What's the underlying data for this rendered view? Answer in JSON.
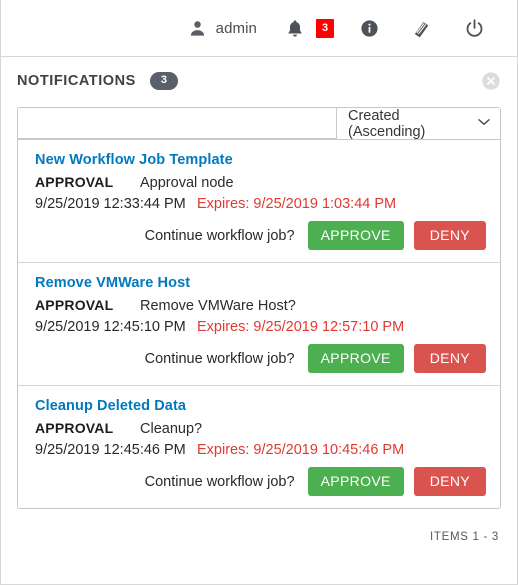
{
  "topbar": {
    "user_icon": "user-icon",
    "user_label": "admin",
    "bell_icon": "bell-icon",
    "bell_badge": "3",
    "info_icon": "info-circle-icon",
    "docs_icon": "book-icon",
    "logout_icon": "power-icon"
  },
  "panel": {
    "title": "NOTIFICATIONS",
    "count": "3",
    "close_icon": "close-circle-icon"
  },
  "toolbar": {
    "search_value": "",
    "search_placeholder": "",
    "sort_value": "Created (Ascending)",
    "sort_chevron": "chevron-down-icon"
  },
  "notifications": [
    {
      "title": "New Workflow Job Template",
      "type_label": "APPROVAL",
      "type_value": "Approval node",
      "created": "9/25/2019 12:33:44 PM",
      "expires": "Expires: 9/25/2019 1:03:44 PM",
      "prompt": "Continue workflow job?",
      "approve_label": "APPROVE",
      "deny_label": "DENY"
    },
    {
      "title": "Remove VMWare Host",
      "type_label": "APPROVAL",
      "type_value": "Remove VMWare Host?",
      "created": "9/25/2019 12:45:10 PM",
      "expires": "Expires: 9/25/2019 12:57:10 PM",
      "prompt": "Continue workflow job?",
      "approve_label": "APPROVE",
      "deny_label": "DENY"
    },
    {
      "title": "Cleanup Deleted Data",
      "type_label": "APPROVAL",
      "type_value": "Cleanup?",
      "created": "9/25/2019 12:45:46 PM",
      "expires": "Expires: 9/25/2019 10:45:46 PM",
      "prompt": "Continue workflow job?",
      "approve_label": "APPROVE",
      "deny_label": "DENY"
    }
  ],
  "footer": {
    "items_label": "ITEMS  1 - 3"
  },
  "colors": {
    "link": "#0279bf",
    "expires": "#e0392f",
    "approve": "#4caf50",
    "deny": "#d9534f",
    "badge_red": "#ff0000",
    "pill_gray": "#5a6069"
  }
}
